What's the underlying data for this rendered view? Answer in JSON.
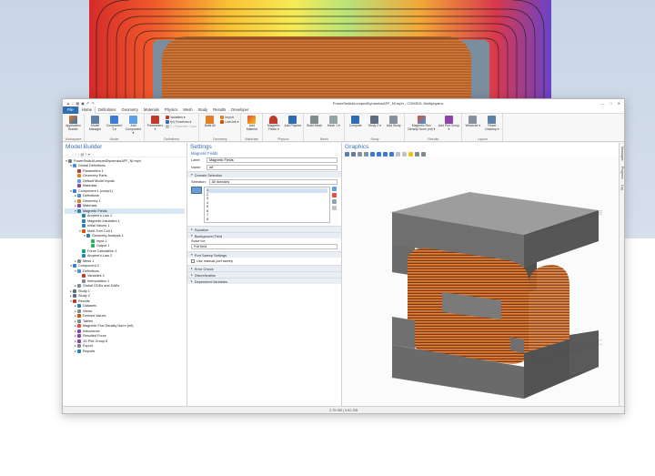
{
  "window": {
    "title": "PowerSwitchLumpedDynamicsAFF_NI.mph - COMSOL Multiphysics",
    "controls": [
      "—",
      "□",
      "✕"
    ]
  },
  "ribbon": {
    "tabs": [
      "File",
      "Home",
      "Definitions",
      "Geometry",
      "Materials",
      "Physics",
      "Mesh",
      "Study",
      "Results",
      "Developer"
    ],
    "active_tab": "Home",
    "groups": {
      "workspace": {
        "label": "Workspace",
        "buttons": [
          "Application Builder"
        ]
      },
      "model": {
        "label": "Model",
        "buttons": [
          "Model Manager",
          "Component 1 ▾",
          "Add Component ▾"
        ]
      },
      "definitions": {
        "label": "Definitions",
        "buttons": [
          "Parameters ▾"
        ],
        "stack": [
          "Variables ▾",
          "f(x) Functions ▾",
          "P₂ Parameter Case"
        ]
      },
      "geometry": {
        "label": "Geometry",
        "buttons": [
          "Build All"
        ],
        "stack": [
          "Import",
          "LiveLink ▾"
        ]
      },
      "materials": {
        "label": "Materials",
        "buttons": [
          "Add Material"
        ]
      },
      "physics": {
        "label": "Physics",
        "buttons": [
          "Magnetic Fields ▾",
          "Add Physics"
        ]
      },
      "mesh": {
        "label": "Mesh",
        "buttons": [
          "Build Mesh",
          "Mesh 1 ▾"
        ]
      },
      "study": {
        "label": "Study",
        "buttons": [
          "Compute",
          "Study 2 ▾",
          "Add Study"
        ]
      },
      "results": {
        "label": "Results",
        "buttons": [
          "Magnetic Flux Density Norm (mf) ▾",
          "Add Plot Group ▾"
        ]
      },
      "layout": {
        "label": "Layout",
        "buttons": [
          "Windows ▾",
          "Reset Desktop ▾"
        ]
      }
    }
  },
  "model_builder": {
    "title": "Model Builder",
    "toolbar": "← → ↑ ↓ ▤ ≡ ▾",
    "tree": [
      {
        "label": "PowerSwitchLumpedDynamicsAFF_NI.mph",
        "indent": 0,
        "twisty": "▾",
        "color": "#7a7a7a"
      },
      {
        "label": "Global Definitions",
        "indent": 1,
        "twisty": "▾",
        "color": "#4a90d9"
      },
      {
        "label": "Parameters 1",
        "indent": 2,
        "twisty": "",
        "color": "#c0392b"
      },
      {
        "label": "Geometry Parts",
        "indent": 2,
        "twisty": "",
        "color": "#e67e22"
      },
      {
        "label": "Default Model Inputs",
        "indent": 2,
        "twisty": "",
        "color": "#5d9cec"
      },
      {
        "label": "Materials",
        "indent": 2,
        "twisty": "",
        "color": "#8e44ad"
      },
      {
        "label": "Component 1 (comp1)",
        "indent": 1,
        "twisty": "▾",
        "color": "#3a7bd5"
      },
      {
        "label": "Definitions",
        "indent": 2,
        "twisty": "▸",
        "color": "#4a90d9"
      },
      {
        "label": "Geometry 1",
        "indent": 2,
        "twisty": "▸",
        "color": "#e67e22"
      },
      {
        "label": "Materials",
        "indent": 2,
        "twisty": "▸",
        "color": "#8e44ad"
      },
      {
        "label": "Magnetic Fields",
        "indent": 2,
        "twisty": "▾",
        "color": "#2980b9",
        "selected": true
      },
      {
        "label": "Ampère's Law 1",
        "indent": 3,
        "twisty": "",
        "color": "#2980b9"
      },
      {
        "label": "Magnetic Insulation 1",
        "indent": 3,
        "twisty": "",
        "color": "#2980b9"
      },
      {
        "label": "Initial Values 1",
        "indent": 3,
        "twisty": "",
        "color": "#2980b9"
      },
      {
        "label": "Multi-Turn Coil 1",
        "indent": 3,
        "twisty": "▾",
        "color": "#d35400"
      },
      {
        "label": "Geometry Analysis 1",
        "indent": 4,
        "twisty": "▾",
        "color": "#2980b9"
      },
      {
        "label": "Input 1",
        "indent": 5,
        "twisty": "",
        "color": "#27ae60"
      },
      {
        "label": "Output 1",
        "indent": 5,
        "twisty": "",
        "color": "#27ae60"
      },
      {
        "label": "Force Calculation 1",
        "indent": 3,
        "twisty": "",
        "color": "#16a085"
      },
      {
        "label": "Ampère's Law 2",
        "indent": 3,
        "twisty": "",
        "color": "#2980b9"
      },
      {
        "label": "Mesh 1",
        "indent": 2,
        "twisty": "▸",
        "color": "#7f8c8d"
      },
      {
        "label": "Component 2",
        "indent": 1,
        "twisty": "▾",
        "color": "#3a7bd5"
      },
      {
        "label": "Definitions",
        "indent": 2,
        "twisty": "▾",
        "color": "#4a90d9"
      },
      {
        "label": "Variables 2",
        "indent": 3,
        "twisty": "",
        "color": "#c0392b"
      },
      {
        "label": "Interpolation 1",
        "indent": 3,
        "twisty": "",
        "color": "#7f8c8d"
      },
      {
        "label": "Global ODEs and DAEs",
        "indent": 2,
        "twisty": "▸",
        "color": "#7f8c8d"
      },
      {
        "label": "Study 1",
        "indent": 1,
        "twisty": "▸",
        "color": "#5d6d7e"
      },
      {
        "label": "Study 2",
        "indent": 1,
        "twisty": "▸",
        "color": "#5d6d7e"
      },
      {
        "label": "Results",
        "indent": 1,
        "twisty": "▾",
        "color": "#c0392b"
      },
      {
        "label": "Datasets",
        "indent": 2,
        "twisty": "▸",
        "color": "#2980b9"
      },
      {
        "label": "Views",
        "indent": 2,
        "twisty": "▸",
        "color": "#7f8c8d"
      },
      {
        "label": "Derived Values",
        "indent": 2,
        "twisty": "▸",
        "color": "#d35400"
      },
      {
        "label": "Tables",
        "indent": 2,
        "twisty": "▸",
        "color": "#7f8c8d"
      },
      {
        "label": "Magnetic Flux Density Norm (mf)",
        "indent": 2,
        "twisty": "▸",
        "color": "#e74c3c"
      },
      {
        "label": "Inductance",
        "indent": 2,
        "twisty": "▸",
        "color": "#8e44ad"
      },
      {
        "label": "Resulted Force",
        "indent": 2,
        "twisty": "▸",
        "color": "#8e44ad"
      },
      {
        "label": "1D Plot Group 8",
        "indent": 2,
        "twisty": "▸",
        "color": "#8e44ad"
      },
      {
        "label": "Export",
        "indent": 2,
        "twisty": "▸",
        "color": "#7f8c8d"
      },
      {
        "label": "Reports",
        "indent": 2,
        "twisty": "▸",
        "color": "#2980b9"
      }
    ]
  },
  "settings": {
    "title": "Settings",
    "subtitle": "Magnetic Fields",
    "label_field": {
      "label": "Label:",
      "value": "Magnetic Fields"
    },
    "name_field": {
      "label": "Name:",
      "value": "mf"
    },
    "domain_selection": {
      "header": "Domain Selection",
      "selection_label": "Selection:",
      "selection_value": "All domains",
      "items": [
        "1",
        "2",
        "3",
        "4",
        "5",
        "6",
        "7",
        "8"
      ]
    },
    "sections": {
      "equation": "Equation",
      "background_field": "Background Field",
      "solve_for_label": "Solve for:",
      "solve_for_value": "Full field",
      "port_sweep": "Port Sweep Settings",
      "use_manual": "Use manual port sweep",
      "error_check": "Error Check",
      "discretization": "Discretization",
      "dependent_variables": "Dependent Variables"
    }
  },
  "graphics": {
    "title": "Graphics"
  },
  "side_tabs": [
    "Messages",
    "Progress",
    "Log"
  ],
  "status": {
    "memory": "2.75 GB | 3.51 GB"
  },
  "colors": {
    "accent": "#2d6fb7",
    "file_tab": "#2c6db3",
    "coil": "#c8692a",
    "core": "#8a8a8a"
  }
}
